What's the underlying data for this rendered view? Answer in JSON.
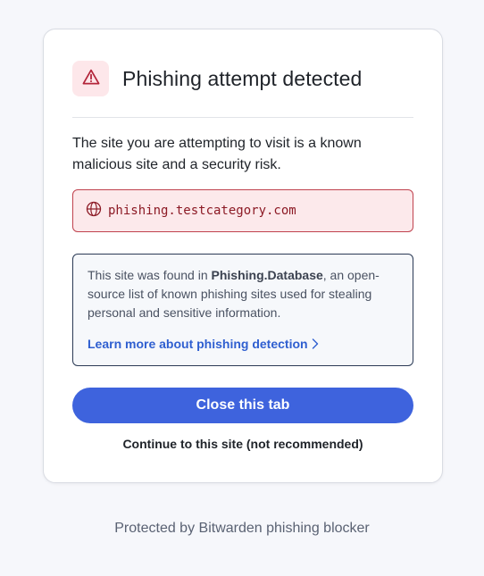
{
  "card": {
    "title": "Phishing attempt detected",
    "warning_icon": "warning-triangle-icon",
    "description": "The site you are attempting to visit is a known malicious site and a security risk.",
    "url_icon": "globe-icon",
    "url": "phishing.testcategory.com",
    "info": {
      "prefix": "This site was found in ",
      "source": "Phishing.Database",
      "suffix": ", an open-source list of known phishing sites used for stealing personal and sensitive information.",
      "learn_more_label": "Learn more about phishing detection",
      "learn_more_icon": "chevron-right-icon"
    },
    "close_button_label": "Close this tab",
    "continue_label": "Continue to this site (not recommended)"
  },
  "footer": {
    "text": "Protected by Bitwarden phishing blocker"
  },
  "colors": {
    "danger": "#c0424e",
    "danger_bg": "#fce9eb",
    "primary": "#3e63dd",
    "link": "#2f5fd0",
    "page_bg": "#f6f7fb"
  }
}
